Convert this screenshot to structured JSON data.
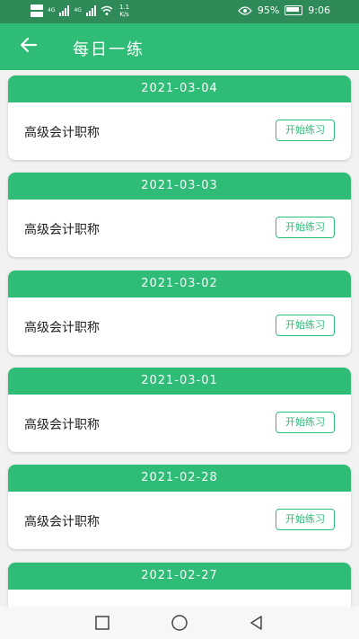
{
  "status_bar": {
    "sim1": "HD",
    "sim2": "HD",
    "network": "4G",
    "network2": "4G",
    "speed_value": "1.1",
    "speed_unit": "K/s",
    "battery": "95%",
    "time": "9:06",
    "icons": [
      "eye-icon",
      "battery-icon",
      "wifi-icon",
      "signal-icon"
    ]
  },
  "app_bar": {
    "title": "每日一练",
    "back_icon": "arrow-left-icon"
  },
  "items": [
    {
      "date": "2021-03-04",
      "label": "高级会计职称",
      "button": "开始练习"
    },
    {
      "date": "2021-03-03",
      "label": "高级会计职称",
      "button": "开始练习"
    },
    {
      "date": "2021-03-02",
      "label": "高级会计职称",
      "button": "开始练习"
    },
    {
      "date": "2021-03-01",
      "label": "高级会计职称",
      "button": "开始练习"
    },
    {
      "date": "2021-02-28",
      "label": "高级会计职称",
      "button": "开始练习"
    },
    {
      "date": "2021-02-27",
      "label": "",
      "button": ""
    }
  ],
  "nav_bar": {
    "buttons": [
      "square-recent-icon",
      "circle-home-icon",
      "triangle-back-icon"
    ]
  },
  "colors": {
    "status_bar": "#2e8a57",
    "primary": "#2ebc77",
    "background": "#f2f2f2"
  }
}
